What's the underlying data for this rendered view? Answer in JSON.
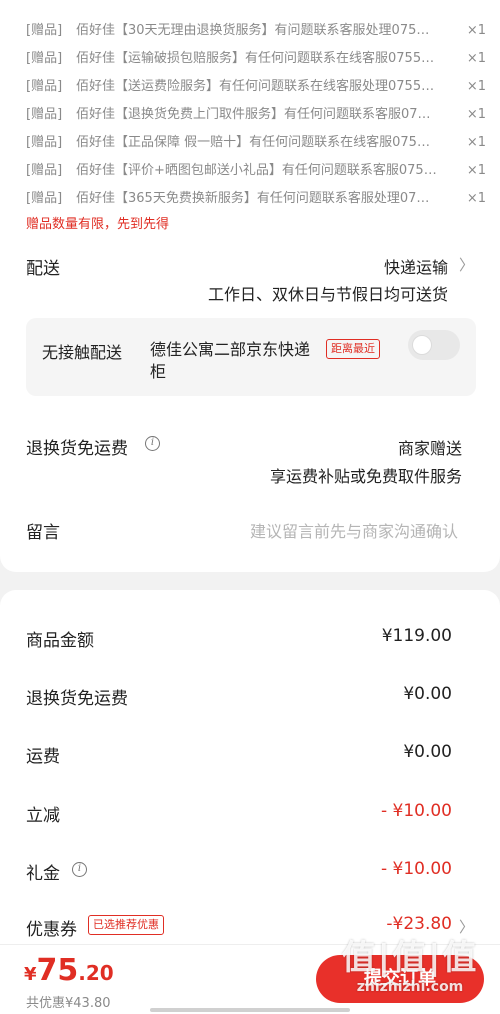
{
  "gifts": {
    "items": [
      {
        "tag": "[赠品]",
        "text": "佰好佳【30天无理由退换货服务】有问题联系客服处理075…",
        "qty": "×1"
      },
      {
        "tag": "[赠品]",
        "text": "佰好佳【运输破损包赔服务】有任何问题联系在线客服0755…",
        "qty": "×1"
      },
      {
        "tag": "[赠品]",
        "text": "佰好佳【送运费险服务】有任何问题联系在线客服处理0755…",
        "qty": "×1"
      },
      {
        "tag": "[赠品]",
        "text": "佰好佳【退换货免费上门取件服务】有任何问题联系客服07…",
        "qty": "×1"
      },
      {
        "tag": "[赠品]",
        "text": "佰好佳【正品保障 假一赔十】有任何问题联系在线客服075…",
        "qty": "×1"
      },
      {
        "tag": "[赠品]",
        "text": "佰好佳【评价+晒图包邮送小礼品】有任何问题联系客服075…",
        "qty": "×1"
      },
      {
        "tag": "[赠品]",
        "text": "佰好佳【365天免费换新服务】有任何问题联系客服处理07…",
        "qty": "×1"
      }
    ],
    "limited_notice": "赠品数量有限，先到先得"
  },
  "delivery": {
    "label": "配送",
    "method": "快递运输",
    "schedule": "工作日、双休日与节假日均可送货",
    "chevron": "chevron-right-icon"
  },
  "contactless": {
    "label": "无接触配送",
    "location": "德佳公寓二部京东快递柜",
    "badge": "距离最近",
    "enabled": false
  },
  "return_shipping": {
    "label": "退换货免运费",
    "value": "商家赠送",
    "detail": "享运费补贴或免费取件服务",
    "info_icon": "i"
  },
  "message": {
    "label": "留言",
    "placeholder": "建议留言前先与商家沟通确认"
  },
  "summary": {
    "goods_label": "商品金额",
    "goods_value": "¥119.00",
    "return_label": "退换货免运费",
    "return_value": "¥0.00",
    "shipping_label": "运费",
    "shipping_value": "¥0.00",
    "discount_label": "立减",
    "discount_value": "- ¥10.00",
    "gift_money_label": "礼金",
    "gift_money_value": "- ¥10.00",
    "gift_money_info_icon": "i",
    "coupon_label": "优惠券",
    "coupon_badge": "已选推荐优惠",
    "coupon_value": "-¥23.80"
  },
  "footer": {
    "currency": "¥",
    "price_int": "75",
    "price_dec": ".20",
    "saved": "共优惠¥43.80",
    "submit_label": "提交订单"
  },
  "watermark": {
    "big": "值|值|值",
    "small": "zhizhizhi.com"
  },
  "colors": {
    "accent": "#e02e24",
    "button": "#e8302a",
    "muted": "#8a8a8a",
    "background": "#f2f2f2"
  }
}
